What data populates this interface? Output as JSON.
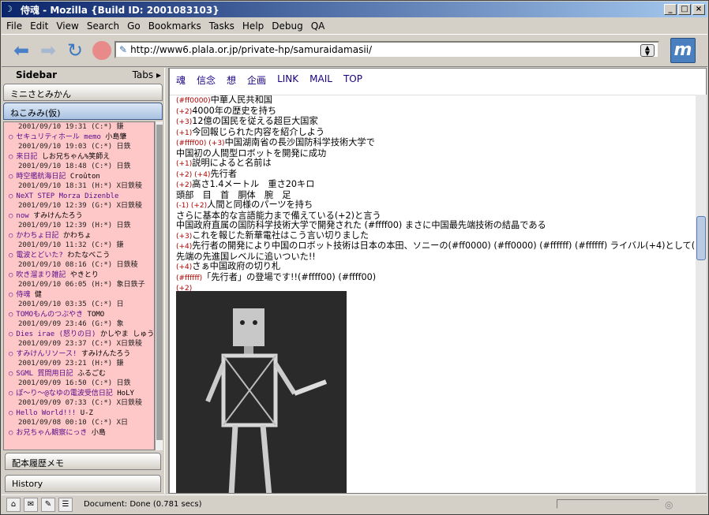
{
  "window": {
    "title": "侍魂 - Mozilla {Build ID: 2001083103}"
  },
  "menu": [
    "File",
    "Edit",
    "View",
    "Search",
    "Go",
    "Bookmarks",
    "Tasks",
    "Help",
    "Debug",
    "QA"
  ],
  "address": {
    "url": "http://www6.plala.or.jp/private-hp/samuraidamasii/"
  },
  "sidebar": {
    "title": "Sidebar",
    "tabs_label": "Tabs",
    "top_panels": [
      "ミニさとみかん",
      "ねこみみ(仮)"
    ],
    "bottom_panels": [
      "配本履歴メモ",
      "History"
    ],
    "items": [
      {
        "date": "2001/09/10 19:31 (C:*) 鎌",
        "title": "",
        "author": ""
      },
      {
        "date": "2001/09/10 19:03 (C:*) 日鉄",
        "title": "セキュリティホール memo",
        "author": "小島肇"
      },
      {
        "date": "2001/09/10 18:48 (C:*) 日鉄",
        "title": "来日記",
        "author": "しお兄ちゃん%笑師え"
      },
      {
        "date": "2001/09/10 18:31 (H:*) X日鉄稜",
        "title": "時空艦航海日記",
        "author": "Croûton"
      },
      {
        "date": "2001/09/10 12:39 (G:*) X日鉄稜",
        "title": "NeXT STEP Morza Dizenble",
        "author": ""
      },
      {
        "date": "2001/09/10 12:39 (H:*) 日鉄",
        "title": "now",
        "author": "すみけんたろう"
      },
      {
        "date": "2001/09/10 11:32 (C:*) 鎌",
        "title": "かわちょ日記",
        "author": "かわちょ"
      },
      {
        "date": "2001/09/10 08:16 (C:*) 日鉄稜",
        "title": "電波とどいた?",
        "author": "わたなべこう"
      },
      {
        "date": "2001/09/10 06:05 (H:*) 象日鉄子",
        "title": "吹き溜まり雑記",
        "author": "やきとり"
      },
      {
        "date": "2001/09/10 03:35 (C:*) 日",
        "title": "侍魂",
        "author": "健"
      },
      {
        "date": "2001/09/09 23:46 (G:*) 象",
        "title": "TOMOもんのつぶやき",
        "author": "TOMO"
      },
      {
        "date": "2001/09/09 23:37 (C:*) X日鉄稜",
        "title": "Dies irae (怒りの日)",
        "author": "かしやま しゅうへい"
      },
      {
        "date": "2001/09/09 23:21 (H:*) 鎌",
        "title": "すみけんリソース!",
        "author": "すみけんたろう"
      },
      {
        "date": "2001/09/09 16:50 (C:*) 日鉄",
        "title": "SGML 質問用日記",
        "author": "ふるごむ"
      },
      {
        "date": "2001/09/09 07:33 (C:*) X日鉄稜",
        "title": "ぽ〜り〜@なゆの電波受信日記",
        "author": "HoLY"
      },
      {
        "date": "2001/09/08 00:10 (C:*) X日",
        "title": "Hello World!!!",
        "author": "U-Z"
      },
      {
        "date": "",
        "title": "お兄ちゃん観察にっき",
        "author": "小島"
      }
    ]
  },
  "page": {
    "nav": [
      "魂",
      "信念",
      "想",
      "企画",
      "LINK",
      "MAIL",
      "TOP"
    ],
    "lines": [
      {
        "tag": "(#ff0000)",
        "text": "中華人民共和国"
      },
      {
        "tag": "(+2)",
        "text": "4000年の歴史を持ち"
      },
      {
        "tag": "(+3)",
        "text": "12億の国民を従える超巨大国家"
      },
      {
        "tag": "(+1)",
        "text": "今回報じられた内容を紹介しよう"
      },
      {
        "tag": "(#ffff00) (+3)",
        "text": "中国湖南省の長沙国防科学技術大学で"
      },
      {
        "tag": "",
        "text": "中国初の人間型ロボットを開発に成功"
      },
      {
        "tag": "(+1)",
        "text": "説明によると名前は"
      },
      {
        "tag": "(+2) (+4)",
        "text": "先行者"
      },
      {
        "tag": "(+2)",
        "text": "高さ1.4メートル　重さ20キロ"
      },
      {
        "tag": "",
        "text": "頭部　目　首　胴体　腕　足"
      },
      {
        "tag": "(-1) (+2)",
        "text": "人間と同様のパーツを持ち"
      },
      {
        "tag": "",
        "text": "さらに基本的な言語能力まで備えている(+2)と言う"
      },
      {
        "tag": "",
        "text": "中国政府直属の国防科学技術大学で開発された (#ffff00) まさに中国最先端技術の結晶である"
      },
      {
        "tag": "(+3)",
        "text": "これを報じた新華電社はこう言い切りました"
      },
      {
        "tag": "(+4)",
        "text": "先行者の開発により中国のロボット技術は日本の本田、ソニーの(#ff0000) (#ff0000) (#ffffff) (#ffffff) ライバル(+4)として(#ff0000) (#ff0000) 最"
      },
      {
        "tag": "",
        "text": "先端の先進国レベルに追いついた!!"
      },
      {
        "tag": "(+4)",
        "text": "さぁ中国政府の切り札"
      },
      {
        "tag": "(#ffffff)",
        "text": "「先行者」の登場です!!(#ffff00) (#ffff00)"
      },
      {
        "tag": "(+2)",
        "text": ""
      },
      {
        "tag": "(+1)",
        "text": ""
      }
    ]
  },
  "status": {
    "text": "Document: Done (0.781 secs)"
  }
}
